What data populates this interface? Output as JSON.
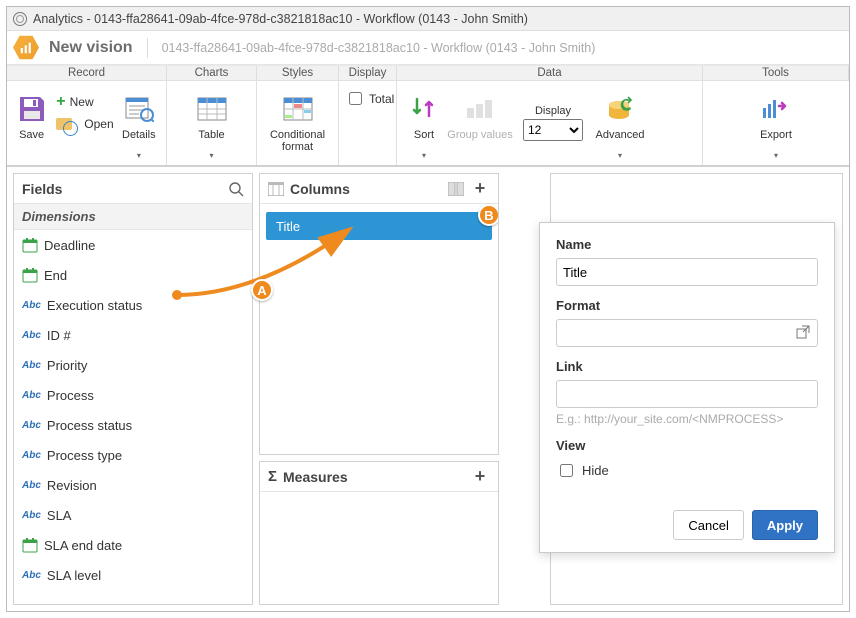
{
  "window_title": "Analytics - 0143-ffa28641-09ab-4fce-978d-c3821818ac10 - Workflow (0143 - John Smith)",
  "header": {
    "title": "New vision",
    "subtitle": "0143-ffa28641-09ab-4fce-978d-c3821818ac10 - Workflow (0143 - John Smith)"
  },
  "categories": {
    "record": "Record",
    "charts": "Charts",
    "styles": "Styles",
    "display": "Display",
    "data": "Data",
    "tools": "Tools"
  },
  "ribbon": {
    "save": "Save",
    "new": "New",
    "open": "Open",
    "details": "Details",
    "table": "Table",
    "conditional_format": "Conditional\nformat",
    "total": "Total",
    "sort": "Sort",
    "group_values": "Group values",
    "display_label": "Display",
    "display_value": "12",
    "advanced": "Advanced",
    "export": "Export"
  },
  "fields": {
    "title": "Fields",
    "dimensions": "Dimensions",
    "items": [
      {
        "type": "cal",
        "label": "Deadline"
      },
      {
        "type": "cal",
        "label": "End"
      },
      {
        "type": "abc",
        "label": "Execution status"
      },
      {
        "type": "abc",
        "label": "ID #"
      },
      {
        "type": "abc",
        "label": "Priority"
      },
      {
        "type": "abc",
        "label": "Process"
      },
      {
        "type": "abc",
        "label": "Process status"
      },
      {
        "type": "abc",
        "label": "Process type"
      },
      {
        "type": "abc",
        "label": "Revision"
      },
      {
        "type": "abc",
        "label": "SLA"
      },
      {
        "type": "cal",
        "label": "SLA end date"
      },
      {
        "type": "abc",
        "label": "SLA level"
      }
    ]
  },
  "columns": {
    "title": "Columns",
    "selected": "Title"
  },
  "measures": {
    "title": "Measures"
  },
  "annotation": {
    "a": "A",
    "b": "B"
  },
  "properties": {
    "name_label": "Name",
    "name_value": "Title",
    "format_label": "Format",
    "format_value": "",
    "link_label": "Link",
    "link_value": "",
    "link_hint": "E.g.: http://your_site.com/<NMPROCESS>",
    "view_label": "View",
    "hide_label": "Hide",
    "cancel": "Cancel",
    "apply": "Apply"
  }
}
